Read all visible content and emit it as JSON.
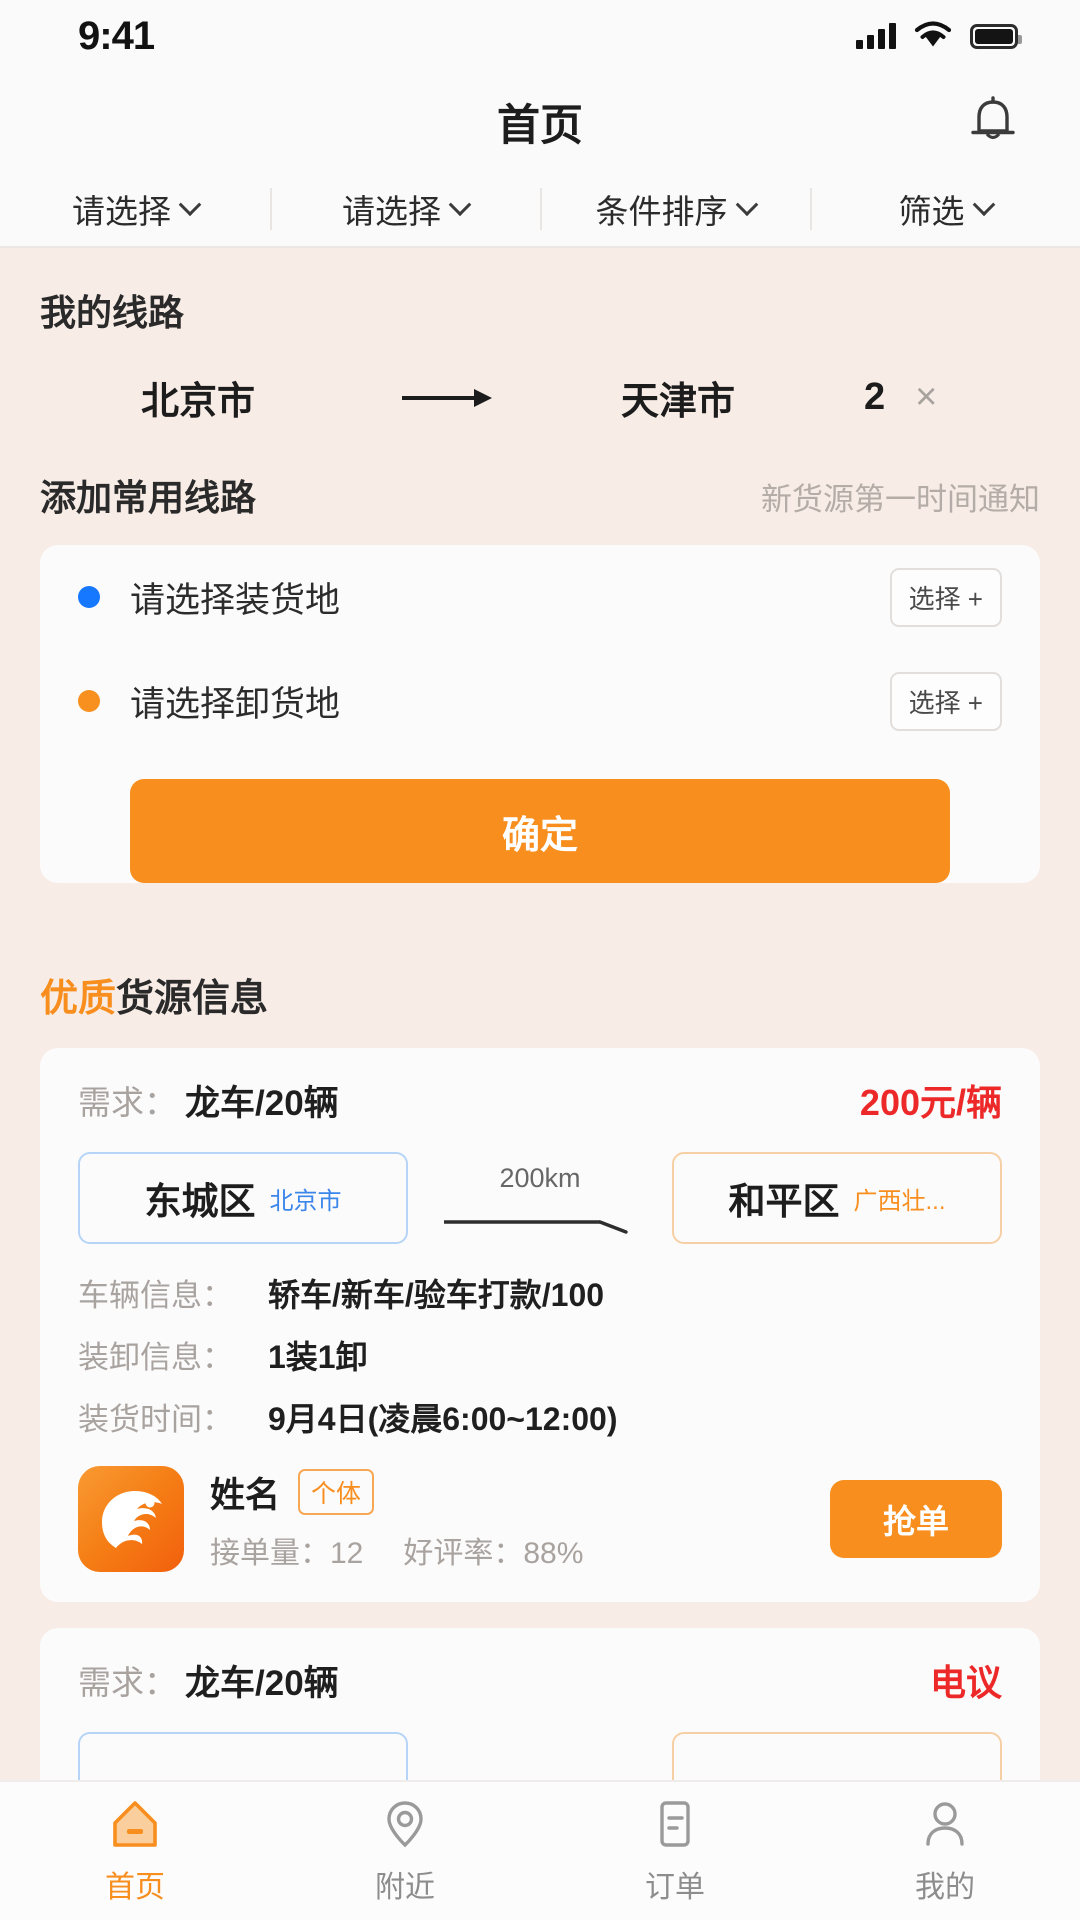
{
  "status_bar": {
    "time": "9:41",
    "signal_icon": "cellular-signal-icon",
    "wifi_icon": "wifi-icon",
    "battery_icon": "battery-icon"
  },
  "header": {
    "title": "首页",
    "bell_icon": "notification-bell-icon"
  },
  "filters": [
    {
      "label": "请选择"
    },
    {
      "label": "请选择"
    },
    {
      "label": "条件排序"
    },
    {
      "label": "筛选"
    }
  ],
  "my_route": {
    "section_title": "我的线路",
    "from": "北京市",
    "arrow": "→",
    "to": "天津市",
    "count": "2",
    "close": "×"
  },
  "add_route": {
    "title": "添加常用线路",
    "hint": "新货源第一时间通知",
    "rows": [
      {
        "label": "请选择装货地",
        "dot_color": "#1678ff",
        "button": "选择 +"
      },
      {
        "label": "请选择卸货地",
        "dot_color": "#f7901e",
        "button": "选择 +"
      }
    ],
    "confirm_label": "确定"
  },
  "goods_section": {
    "title_highlight": "优质",
    "title_rest": "货源信息",
    "cards": [
      {
        "demand_label": "需求：",
        "demand_value": "龙车/20辆",
        "price": "200元/辆",
        "from_city": "东城区",
        "from_province": "北京市",
        "distance": "200km",
        "to_city": "和平区",
        "to_province": "广西壮...",
        "details": [
          {
            "label": "车辆信息：",
            "value": "轿车/新车/验车打款/100"
          },
          {
            "label": "装卸信息：",
            "value": "1装1卸"
          },
          {
            "label": "装货时间：",
            "value": "9月4日(凌晨6:00~12:00)"
          }
        ],
        "shipper": {
          "avatar_icon": "company-logo-icon",
          "name": "姓名",
          "badge": "个体",
          "orders_label": "接单量：",
          "orders_value": "12",
          "rating_label": "好评率：",
          "rating_value": "88%",
          "action_label": "抢单"
        }
      },
      {
        "demand_label": "需求：",
        "demand_value": "龙车/20辆",
        "price": "电议"
      }
    ]
  },
  "tabbar": [
    {
      "label": "首页",
      "icon": "home-icon",
      "active": true
    },
    {
      "label": "附近",
      "icon": "location-pin-icon",
      "active": false
    },
    {
      "label": "订单",
      "icon": "order-document-icon",
      "active": false
    },
    {
      "label": "我的",
      "icon": "person-icon",
      "active": false
    }
  ],
  "colors": {
    "brand_orange": "#f78e1e",
    "price_red": "#ec2828",
    "origin_blue": "#1678ff",
    "page_bg": "#f7ece6"
  }
}
